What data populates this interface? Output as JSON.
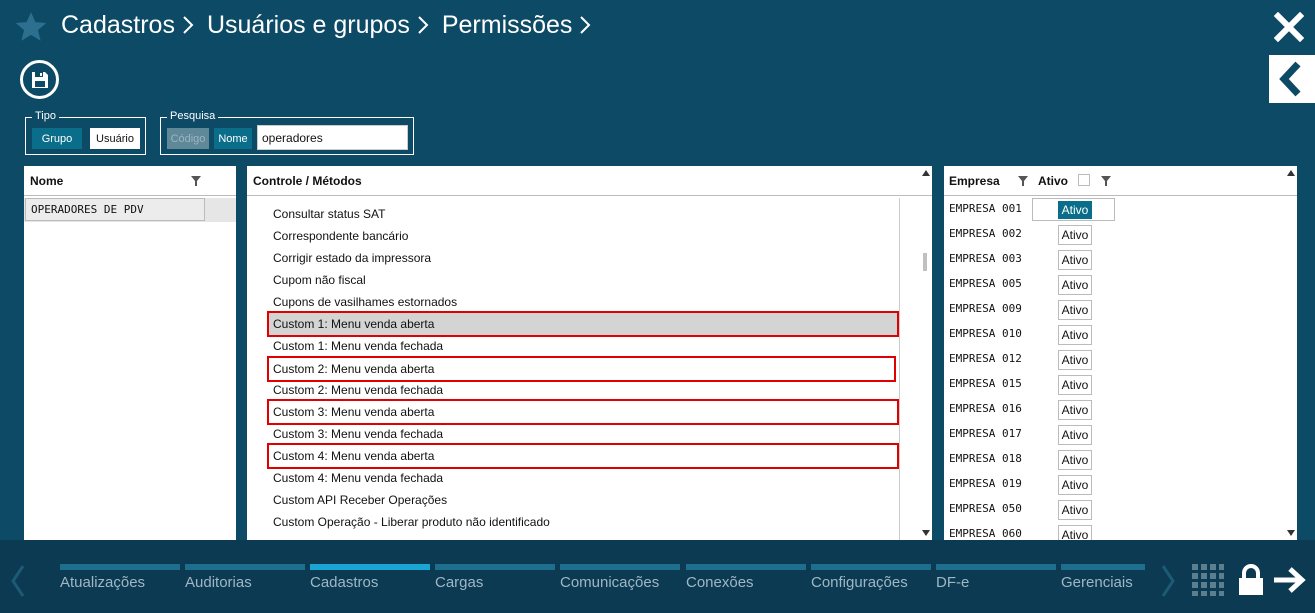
{
  "header": {
    "breadcrumb": [
      "Cadastros",
      "Usuários e grupos",
      "Permissões"
    ]
  },
  "tipo": {
    "legend": "Tipo",
    "options": [
      "Grupo",
      "Usuário"
    ],
    "selected": "Grupo"
  },
  "pesquisa": {
    "legend": "Pesquisa",
    "options": [
      "Código",
      "Nome"
    ],
    "selected": "Nome",
    "value": "operadores"
  },
  "nome_panel": {
    "header": "Nome",
    "rows": [
      "OPERADORES DE PDV"
    ]
  },
  "controle_panel": {
    "header": "Controle / Métodos",
    "rows": [
      "Consultar status SAT",
      "Correspondente bancário",
      "Corrigir estado da impressora",
      "Cupom não fiscal",
      "Cupons de vasilhames estornados",
      "Custom 1: Menu venda aberta",
      "Custom 1: Menu venda fechada",
      "Custom 2: Menu venda aberta",
      "Custom 2: Menu venda fechada",
      "Custom 3: Menu venda aberta",
      "Custom 3: Menu venda fechada",
      "Custom 4: Menu venda aberta",
      "Custom 4: Menu venda fechada",
      "Custom API Receber Operações",
      "Custom Operação - Liberar produto não identificado"
    ]
  },
  "empresa_panel": {
    "header_empresa": "Empresa",
    "header_ativo": "Ativo",
    "rows": [
      {
        "empresa": "EMPRESA 001",
        "ativo": "Ativo"
      },
      {
        "empresa": "EMPRESA 002",
        "ativo": "Ativo"
      },
      {
        "empresa": "EMPRESA 003",
        "ativo": "Ativo"
      },
      {
        "empresa": "EMPRESA 005",
        "ativo": "Ativo"
      },
      {
        "empresa": "EMPRESA 009",
        "ativo": "Ativo"
      },
      {
        "empresa": "EMPRESA 010",
        "ativo": "Ativo"
      },
      {
        "empresa": "EMPRESA 012",
        "ativo": "Ativo"
      },
      {
        "empresa": "EMPRESA 015",
        "ativo": "Ativo"
      },
      {
        "empresa": "EMPRESA 016",
        "ativo": "Ativo"
      },
      {
        "empresa": "EMPRESA 017",
        "ativo": "Ativo"
      },
      {
        "empresa": "EMPRESA 018",
        "ativo": "Ativo"
      },
      {
        "empresa": "EMPRESA 019",
        "ativo": "Ativo"
      },
      {
        "empresa": "EMPRESA 050",
        "ativo": "Ativo"
      },
      {
        "empresa": "EMPRESA 060",
        "ativo": "Ativo"
      }
    ]
  },
  "bottom_nav": {
    "items": [
      "Atualizações",
      "Auditorias",
      "Cadastros",
      "Cargas",
      "Comunicações",
      "Conexões",
      "Configurações",
      "DF-e",
      "Gerenciais"
    ],
    "active": "Cadastros"
  },
  "colors": {
    "background": "#0d4a66",
    "accent": "#0a6e8a",
    "highlight_border": "#e00000"
  },
  "icons": [
    "star-icon",
    "chevron-right-icon",
    "close-icon",
    "save-icon",
    "back-icon",
    "filter-icon",
    "grid-icon",
    "lock-icon",
    "arrow-right-icon"
  ]
}
